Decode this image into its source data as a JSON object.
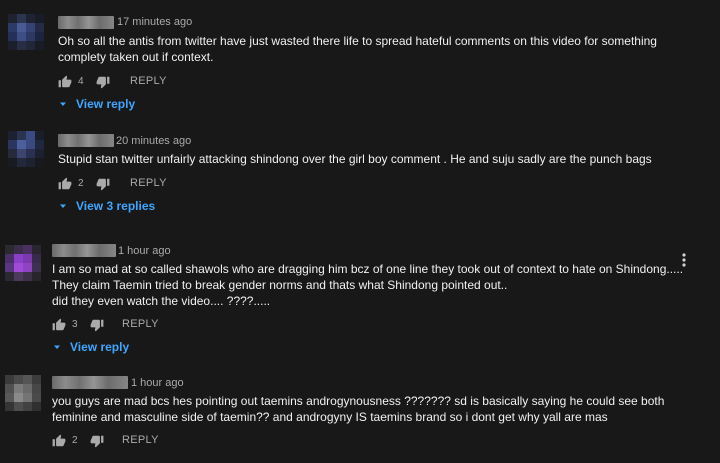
{
  "comments": [
    {
      "time": "17 minutes ago",
      "lines": [
        "Oh so all the antis from twitter have just wasted there life to spread hateful comments on this video for something",
        "complety taken out if context."
      ],
      "likes": "4",
      "reply_label": "REPLY",
      "replies_label": "View reply"
    },
    {
      "time": "20 minutes ago",
      "lines": [
        "Stupid stan twitter unfairly attacking shindong over the girl boy comment . He and suju sadly are the punch bags"
      ],
      "likes": "2",
      "reply_label": "REPLY",
      "replies_label": "View 3 replies"
    },
    {
      "time": "1 hour ago",
      "lines": [
        "I am so mad at so called shawols who are dragging him bcz of one line they took out of context to hate on Shindong.....",
        "They claim Taemin tried to break gender norms and thats what Shindong pointed out..",
        "did they even watch the video....  ????....."
      ],
      "likes": "3",
      "reply_label": "REPLY",
      "replies_label": "View reply"
    },
    {
      "time": "1 hour ago",
      "lines": [
        "you guys are mad bcs hes pointing out taemins androgynousness ??????? sd is basically saying he could see both",
        "feminine and masculine side of taemin?? and androgyny IS taemins brand so i dont get why yall are mas"
      ],
      "likes": "2",
      "reply_label": "REPLY",
      "replies_label": ""
    }
  ]
}
